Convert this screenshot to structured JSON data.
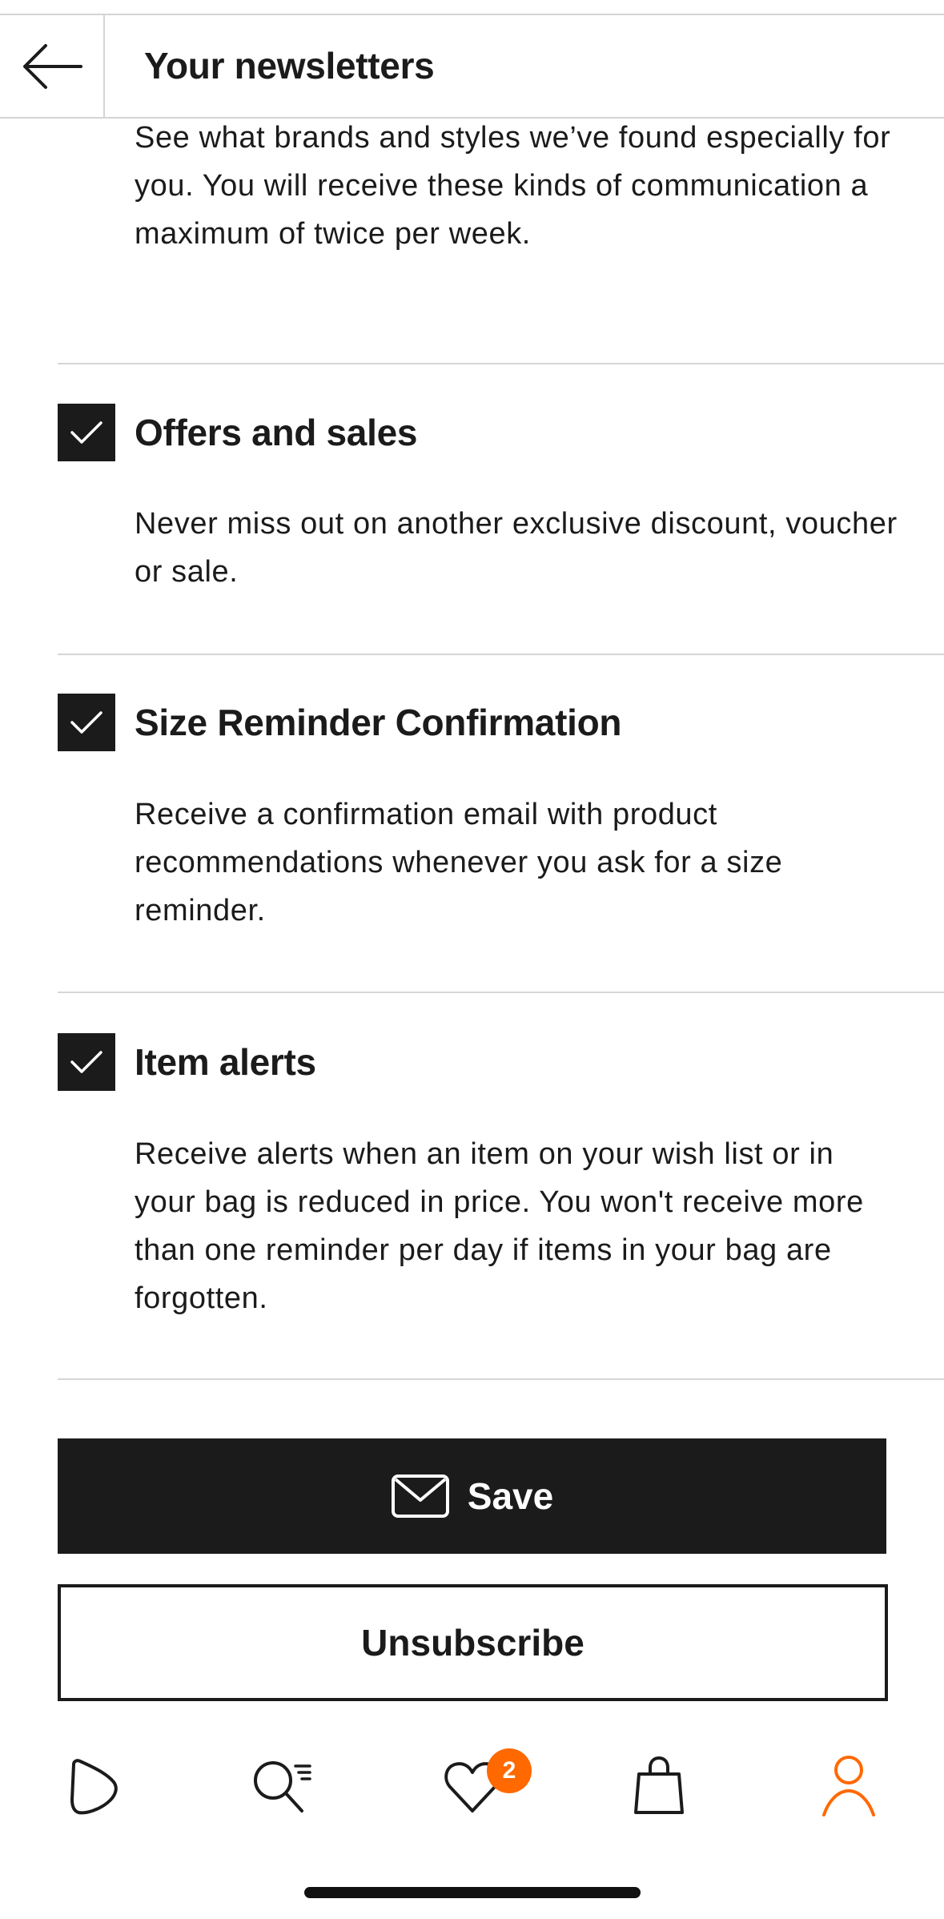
{
  "header": {
    "title": "Your newsletters"
  },
  "intro": {
    "description": "See what brands and styles we’ve found especially for you. You will receive these kinds of communication a maximum of twice per week."
  },
  "newsletters": [
    {
      "title": "Offers and sales",
      "description": "Never miss out on another exclusive discount, voucher or sale.",
      "checked": true
    },
    {
      "title": "Size Reminder Confirmation",
      "description": "Receive a confirmation email with product recommendations whenever you ask for a size reminder.",
      "checked": true
    },
    {
      "title": "Item alerts",
      "description": "Receive alerts when an item on your wish list or in your bag is reduced in price. You won't receive more than one reminder per day if items in your bag are forgotten.",
      "checked": true
    }
  ],
  "actions": {
    "save_label": "Save",
    "unsubscribe_label": "Unsubscribe"
  },
  "tabbar": {
    "items": [
      {
        "icon": "home-icon",
        "active": false
      },
      {
        "icon": "search-icon",
        "active": false
      },
      {
        "icon": "heart-icon",
        "active": false
      },
      {
        "icon": "bag-icon",
        "active": false
      },
      {
        "icon": "profile-icon",
        "active": true
      }
    ],
    "wishlist_badge": "2"
  },
  "colors": {
    "accent": "#ff6900",
    "primary": "#1b1b1b",
    "divider": "#d6d6d6"
  }
}
